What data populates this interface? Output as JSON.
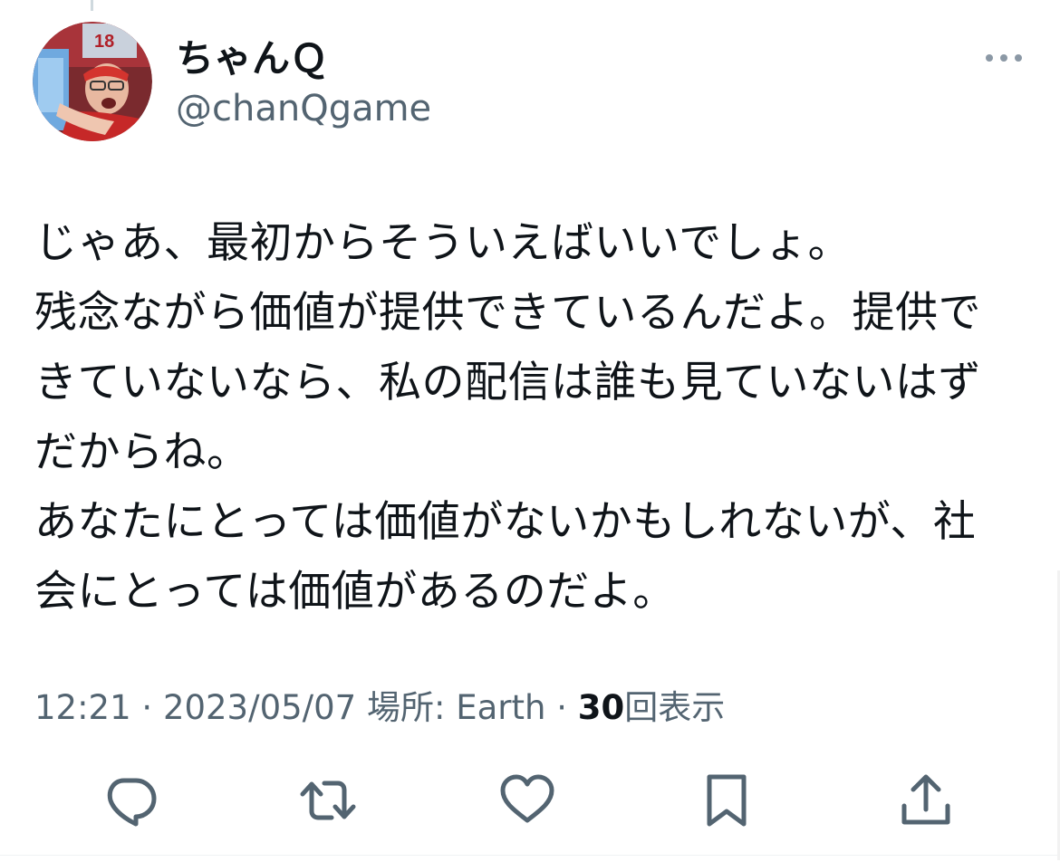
{
  "tweet": {
    "author": {
      "display_name": "ちゃんＱ",
      "handle": "@chanQgame",
      "avatar_icon": "user-avatar-photo"
    },
    "text_lines": [
      "じゃあ、最初からそういえばいいでしょ。",
      "残念ながら価値が提供できているんだよ。提供で",
      "きていないなら、私の配信は誰も見ていないはず",
      "だからね。",
      "あなたにとっては価値がないかもしれないが、社",
      "会にとっては価値があるのだよ。"
    ],
    "meta": {
      "time": "12:21",
      "separator": "·",
      "date": "2023/05/07",
      "location_label": "場所: Earth",
      "views_count": "30",
      "views_label": "回表示"
    }
  },
  "actions": {
    "reply_icon": "reply-icon",
    "retweet_icon": "retweet-icon",
    "like_icon": "heart-icon",
    "bookmark_icon": "bookmark-icon",
    "share_icon": "share-icon",
    "more_icon": "more-dots-icon"
  },
  "colors": {
    "text": "#0f1419",
    "secondary": "#536471",
    "icon": "#536471",
    "divider": "#eff3f4"
  }
}
